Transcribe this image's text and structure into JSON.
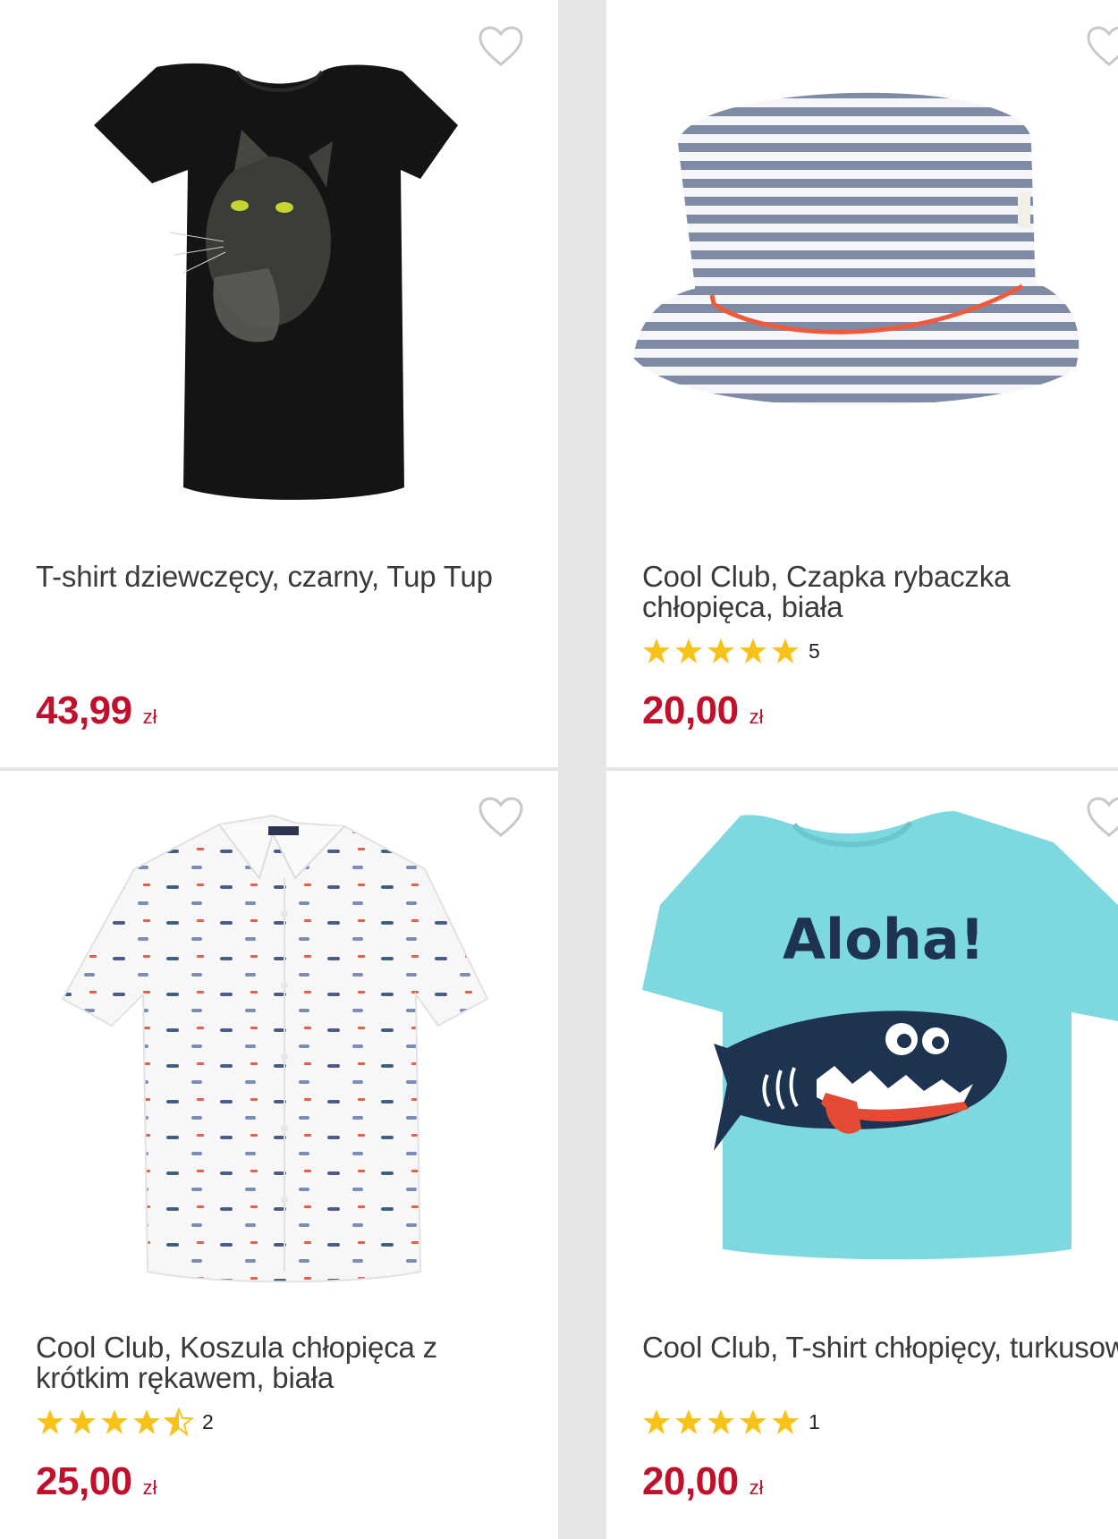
{
  "products": [
    {
      "name": "T-shirt dziewczęcy, czarny, Tup Tup",
      "rating_count": "",
      "stars": 0,
      "price": "43,99",
      "currency": "zł",
      "image_icon": "black-cat-tshirt-image"
    },
    {
      "name": "Cool Club, Czapka rybaczka chłopięca, biała",
      "rating_count": "5",
      "stars": 5,
      "price": "20,00",
      "currency": "zł",
      "image_icon": "striped-bucket-hat-image"
    },
    {
      "name": "Cool Club, Koszula chłopięca z krótkim rękawem, biała",
      "rating_count": "2",
      "stars": 4.5,
      "price": "25,00",
      "currency": "zł",
      "image_icon": "white-shirt-image"
    },
    {
      "name": "Cool Club, T-shirt chłopięcy, turkusowy",
      "rating_count": "1",
      "stars": 5,
      "price": "20,00",
      "currency": "zł",
      "image_icon": "aloha-shark-tshirt-image",
      "print_text": "Aloha!"
    }
  ],
  "colors": {
    "price": "#c0102c",
    "star": "#f7c21a",
    "heart_outline": "#c8c8c8",
    "shirt_turquoise": "#7dd8df",
    "shark_navy": "#1e3350"
  }
}
